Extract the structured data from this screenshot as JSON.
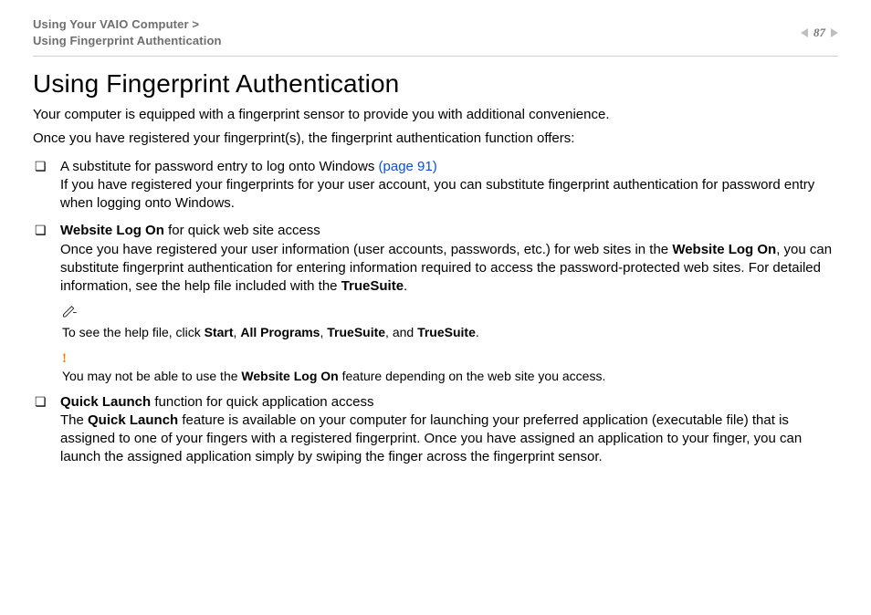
{
  "header": {
    "crumb1": "Using Your VAIO Computer >",
    "crumb2": "Using Fingerprint Authentication",
    "page_number": "87",
    "page_n": 87
  },
  "title": "Using Fingerprint Authentication",
  "intro1": "Your computer is equipped with a fingerprint sensor to provide you with additional convenience.",
  "intro2": "Once you have registered your fingerprint(s), the fingerprint authentication function offers:",
  "bullets": {
    "b1": {
      "lead": "A substitute for password entry to log onto Windows ",
      "link": "(page 91)",
      "link_target_page": 91,
      "body": "If you have registered your fingerprints for your user account, you can substitute fingerprint authentication for password entry when logging onto Windows."
    },
    "b2": {
      "bold1": "Website Log On",
      "after_bold": " for quick web site access",
      "line2_a": "Once you have registered your user information (user accounts, passwords, etc.) for web sites in the ",
      "line2_bold": "Website Log On",
      "line2_b": ", you can substitute fingerprint authentication for entering information required to access the password-protected web sites.",
      "line3_a": "For detailed information, see the help file included with the ",
      "line3_bold": "TrueSuite",
      "line3_b": "."
    },
    "b3": {
      "bold1": "Quick Launch",
      "after_bold": " function for quick application access",
      "line2_a": "The ",
      "line2_bold": "Quick Launch",
      "line2_b": " feature is available on your computer for launching your preferred application (executable file) that is assigned to one of your fingers with a registered fingerprint. Once you have assigned an application to your finger, you can launch the assigned application simply by swiping the finger across the fingerprint sensor."
    }
  },
  "notes": {
    "tip_a": "To see the help file, click ",
    "tip_b1": "Start",
    "tip_s1": ", ",
    "tip_b2": "All Programs",
    "tip_s2": ", ",
    "tip_b3": "TrueSuite",
    "tip_s3": ", and ",
    "tip_b4": "TrueSuite",
    "tip_end": ".",
    "warn_a": "You may not be able to use the ",
    "warn_b": "Website Log On",
    "warn_c": " feature depending on the web site you access."
  }
}
